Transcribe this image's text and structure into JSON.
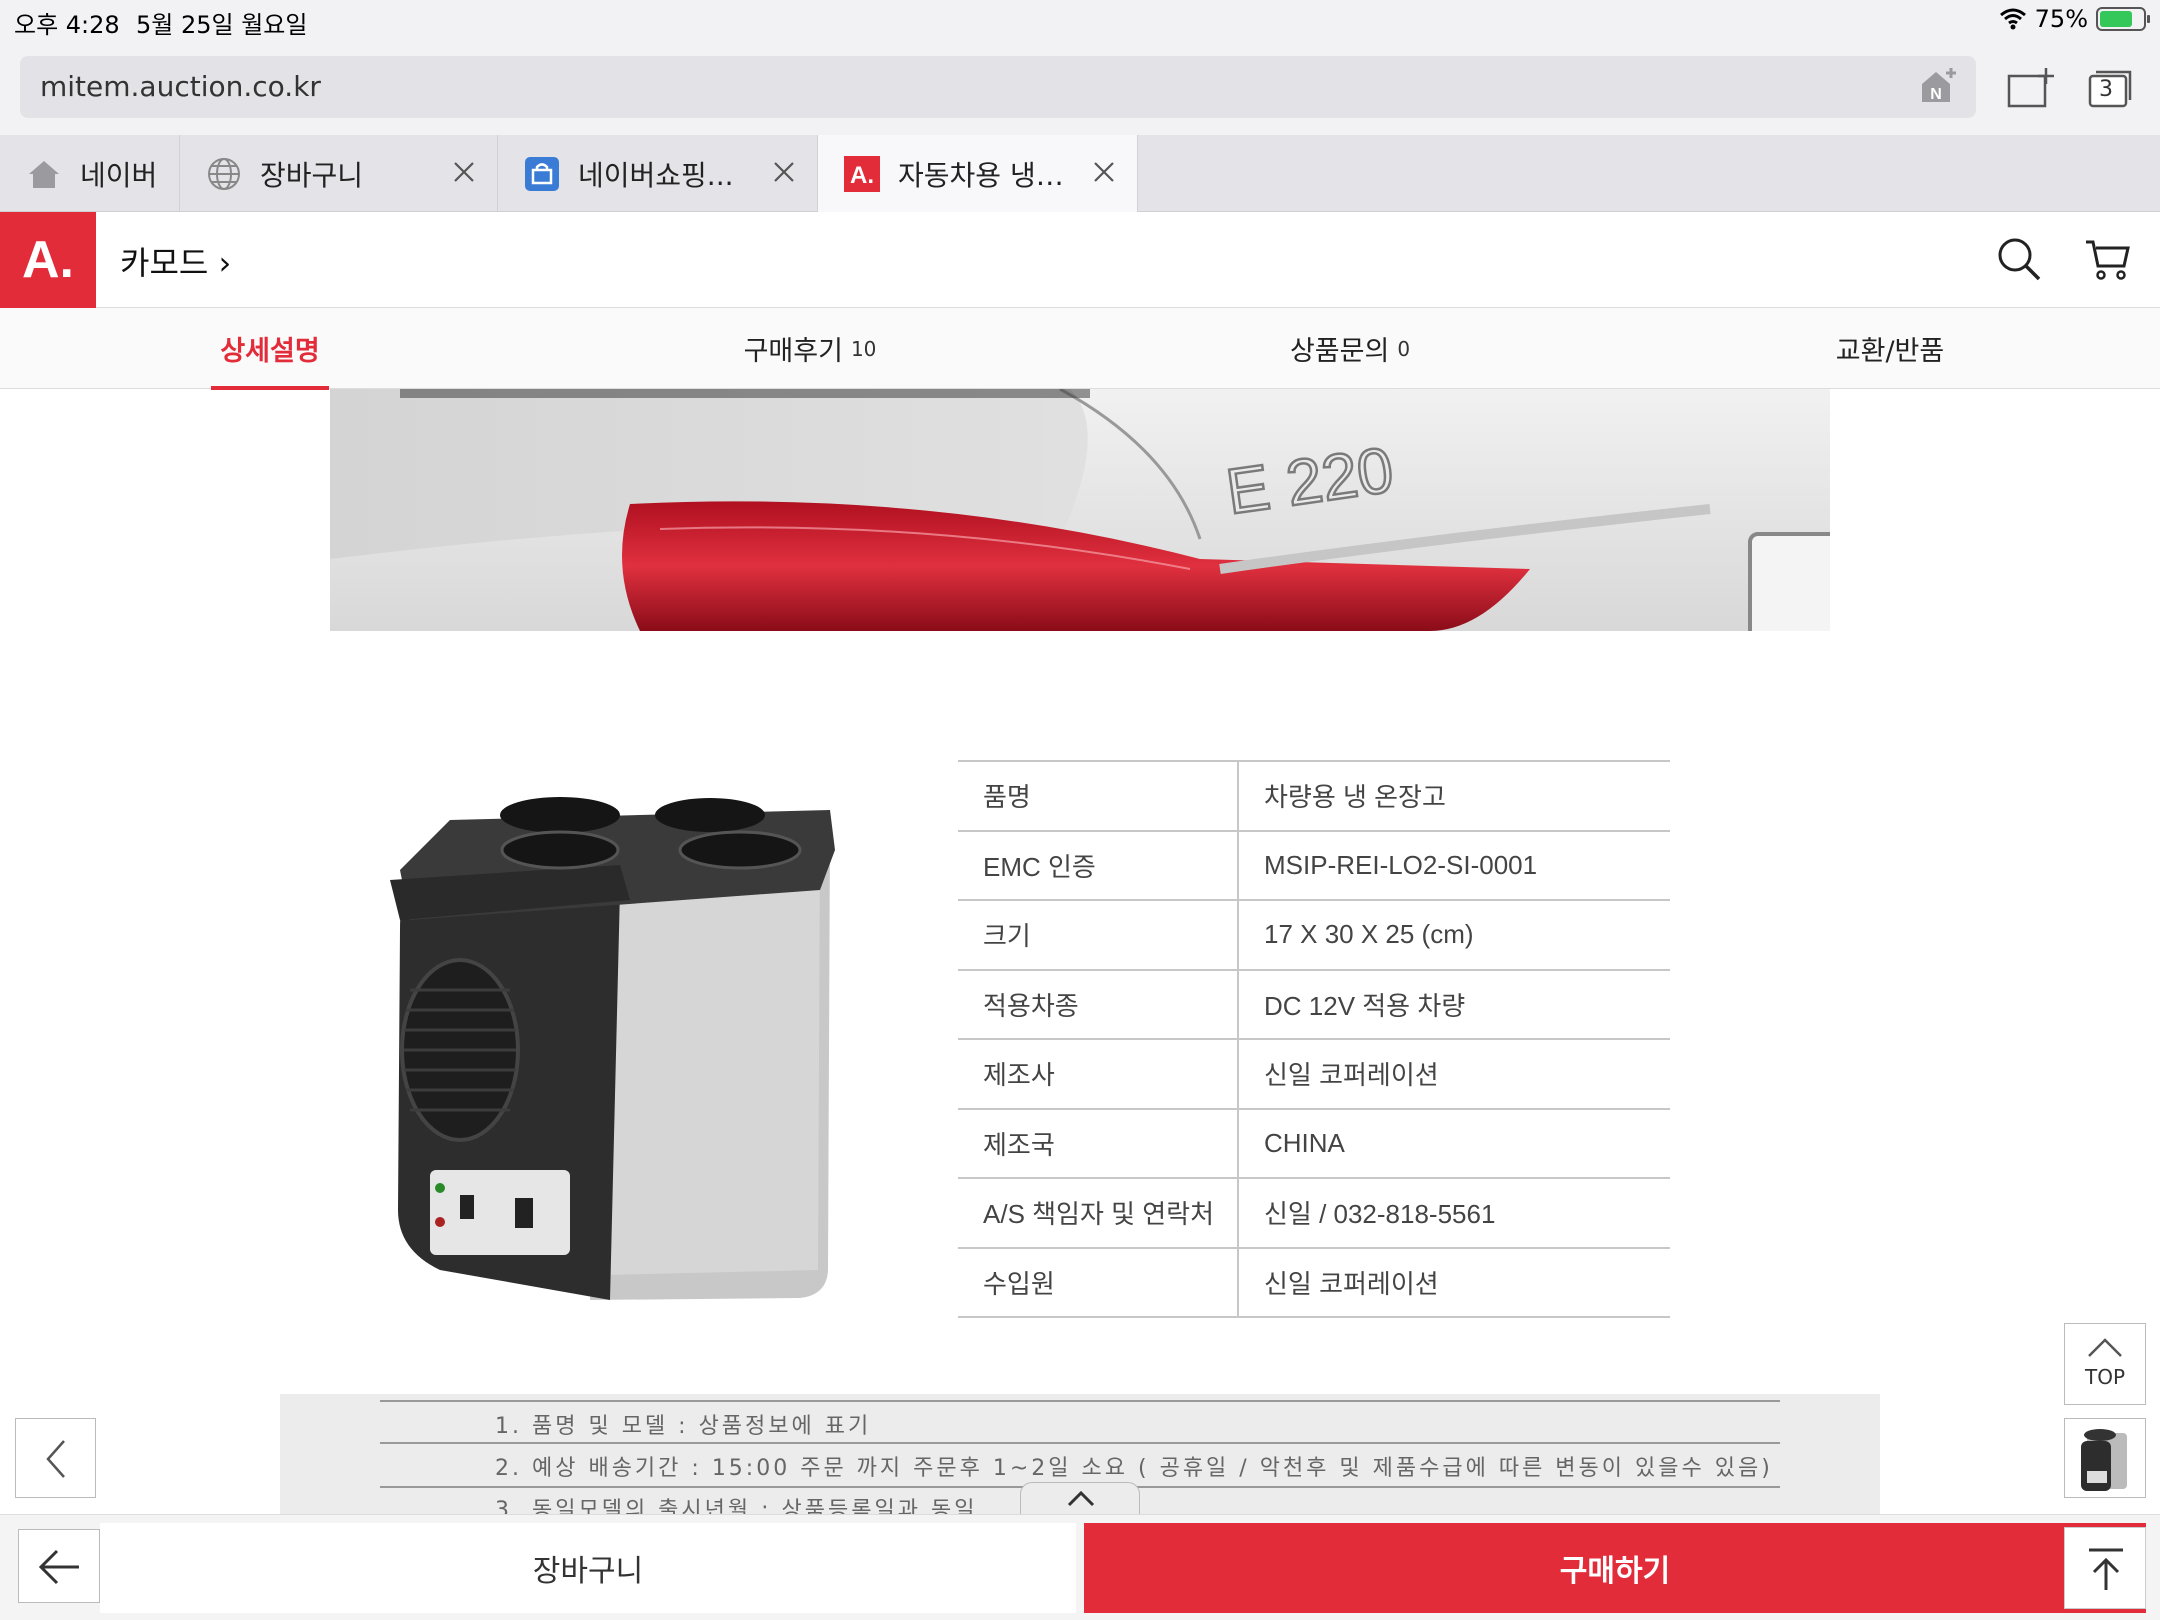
{
  "status_bar": {
    "time": "오후 4:28",
    "date": "5월 25일 월요일",
    "battery": "75%",
    "battery_level": 0.75
  },
  "browser": {
    "url": "mitem.auction.co.kr",
    "tab_count": "3",
    "tabs": [
      {
        "label": "네이버",
        "icon": "home-icon"
      },
      {
        "label": "장바구니",
        "icon": "globe-icon"
      },
      {
        "label": "네이버쇼핑...",
        "icon": "shopping-icon"
      },
      {
        "label": "자동차용 냉…",
        "icon": "auction-logo-icon"
      }
    ]
  },
  "site_header": {
    "logo": "A.",
    "breadcrumb": "카모드 ›"
  },
  "detail_tabs": [
    {
      "label": "상세설명",
      "count": ""
    },
    {
      "label": "구매후기",
      "count": "10"
    },
    {
      "label": "상품문의",
      "count": "0"
    },
    {
      "label": "교환/반품",
      "count": ""
    }
  ],
  "banner": {
    "badge": "E 220"
  },
  "spec_table": [
    {
      "key": "품명",
      "value": "차량용 냉 온장고"
    },
    {
      "key": "EMC 인증",
      "value": "MSIP-REI-LO2-SI-0001"
    },
    {
      "key": "크기",
      "value": "17 X 30 X 25 (cm)"
    },
    {
      "key": "적용차종",
      "value": "DC 12V 적용 차량"
    },
    {
      "key": "제조사",
      "value": "신일 코퍼레이션"
    },
    {
      "key": "제조국",
      "value": "CHINA"
    },
    {
      "key": "A/S 책임자 및 연락처",
      "value": "신일 / 032-818-5561"
    },
    {
      "key": "수입원",
      "value": "신일 코퍼레이션"
    }
  ],
  "notice": [
    "1. 품명 및 모델 : 상품정보에 표기",
    "2. 예상 배송기간 : 15:00 주문 까지 주문후  1~2일 소요  ( 공휴일 / 악천후 및 제품수급에 따른 변동이 있을수 있음)",
    "3. 동일모델의 출시년월 : 상품등록일과 동일"
  ],
  "side": {
    "top_label": "TOP"
  },
  "bottom_bar": {
    "cart_label": "장바구니",
    "buy_label": "구매하기"
  },
  "colors": {
    "accent": "#e32c3a"
  }
}
